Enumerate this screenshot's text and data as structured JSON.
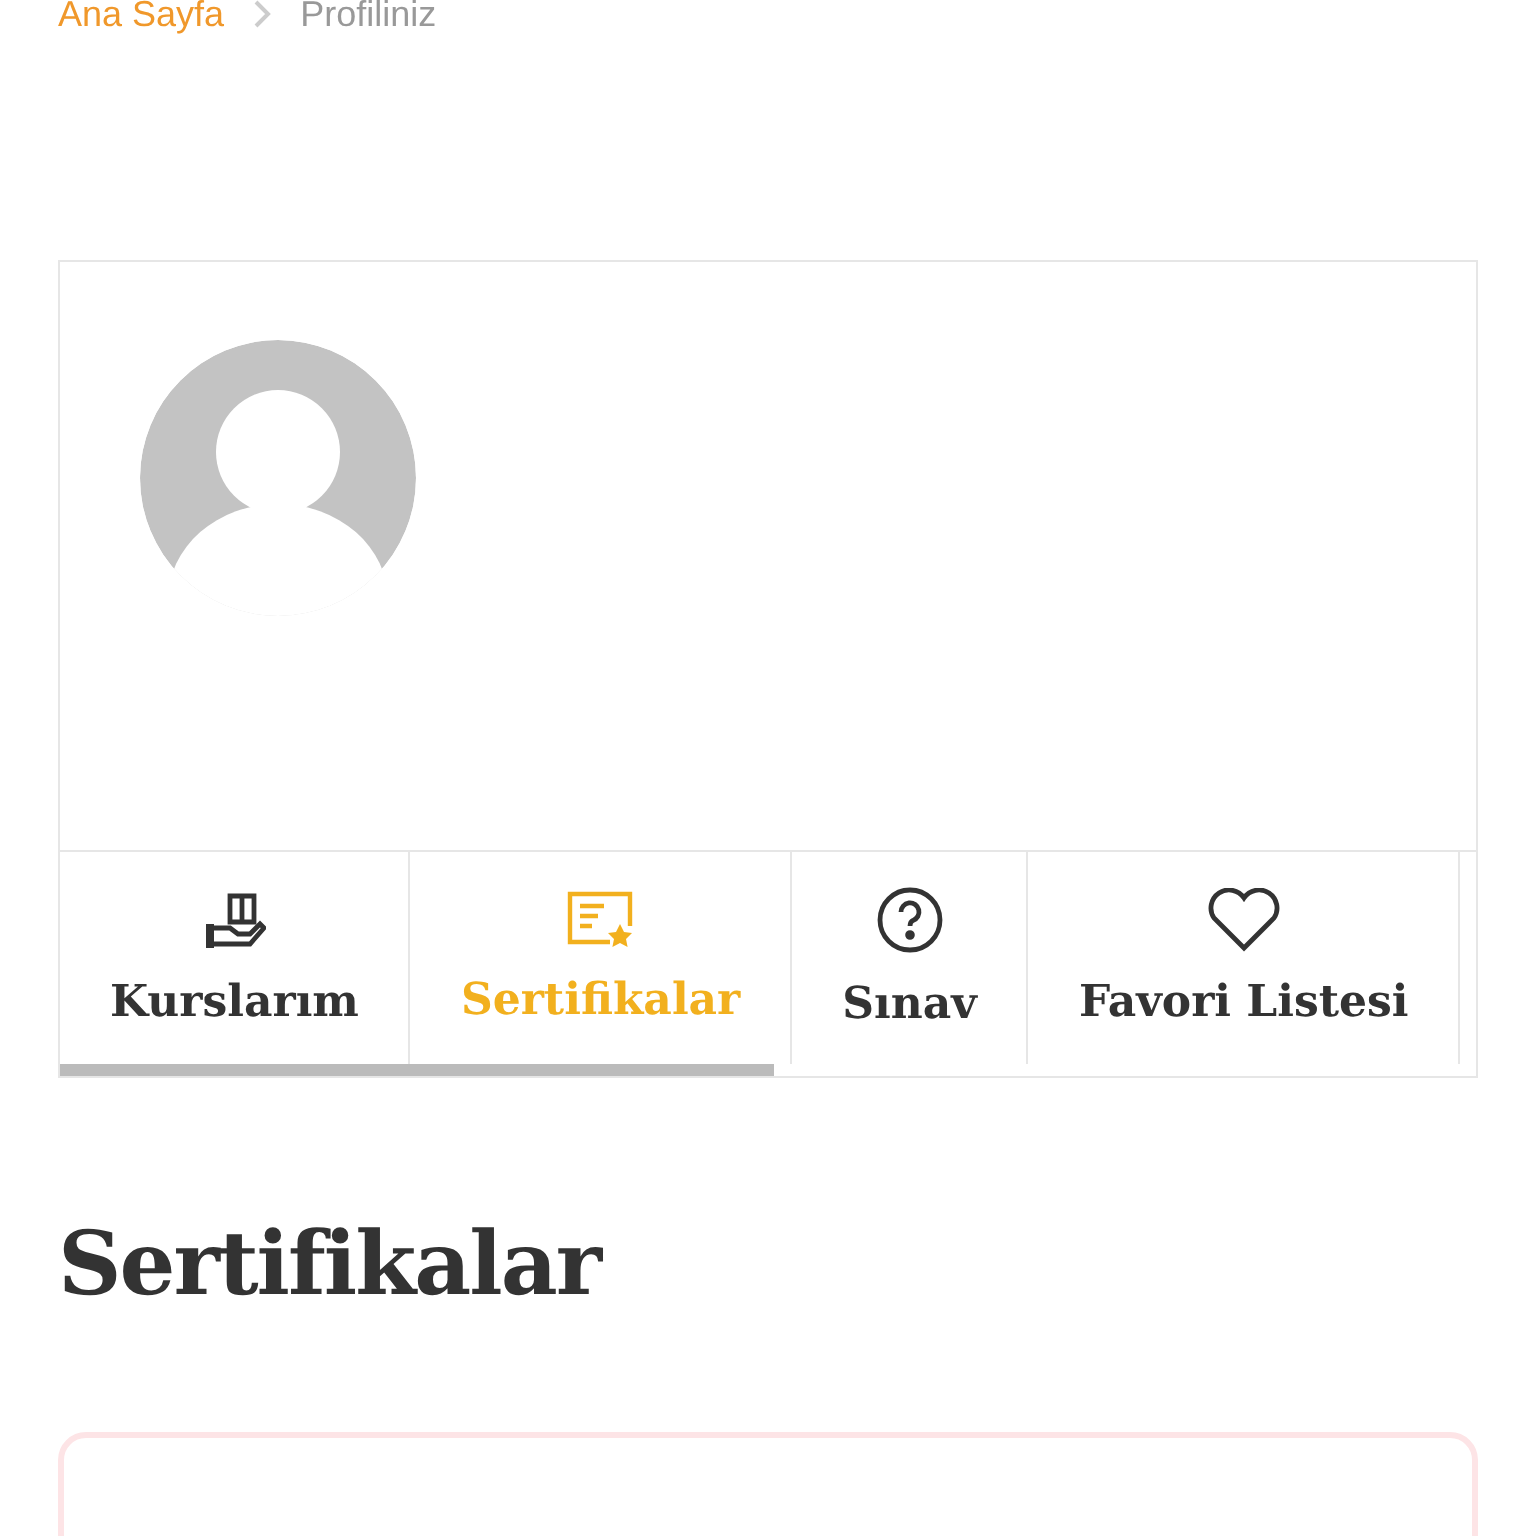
{
  "breadcrumb": [
    {
      "label": "Ana Sayfa",
      "kind": "link"
    },
    {
      "label": "Profiliniz",
      "kind": "current"
    }
  ],
  "profile": {
    "tabs": [
      {
        "label": "Kurslarım",
        "kind": "courses",
        "selected": false
      },
      {
        "label": "Sertifikalar",
        "kind": "certificate",
        "selected": true
      },
      {
        "label": "Sınav",
        "kind": "question",
        "selected": false
      },
      {
        "label": "Favori Listesi",
        "kind": "heart",
        "selected": false
      }
    ]
  },
  "section": {
    "title": "Sertifikalar"
  }
}
